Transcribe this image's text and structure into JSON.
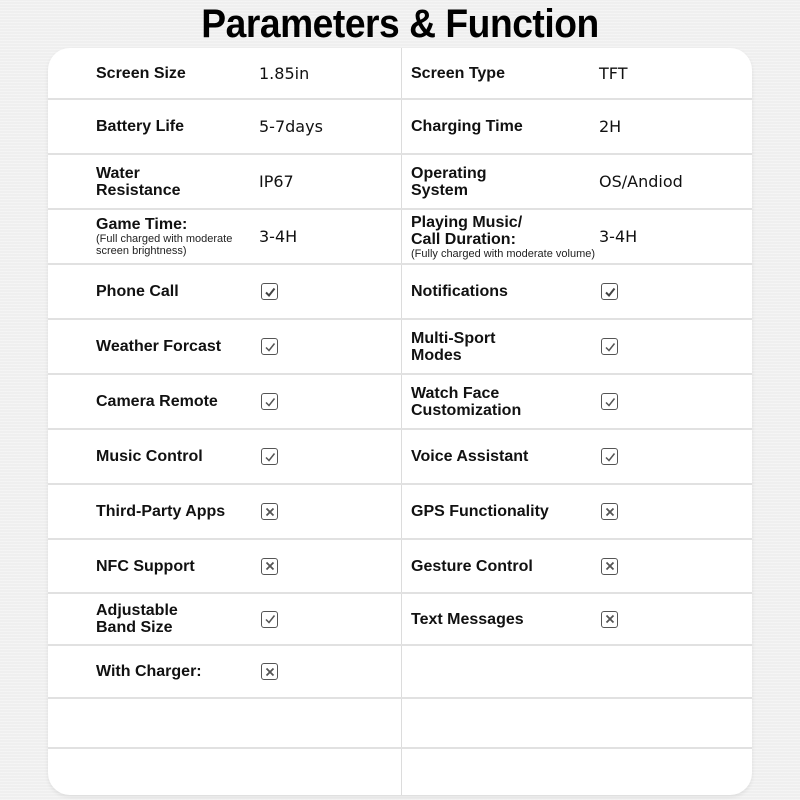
{
  "title": "Parameters & Function",
  "rows": [
    {
      "left": {
        "label": "Screen Size",
        "value": "1.85in"
      },
      "right": {
        "label": "Screen Type",
        "value": "TFT"
      }
    },
    {
      "left": {
        "label": "Battery Life",
        "value": "5-7days"
      },
      "right": {
        "label": "Charging Time",
        "value": "2H"
      }
    },
    {
      "left": {
        "label": "Water Resistance",
        "label_lines": [
          "Water",
          "Resistance"
        ],
        "value": "IP67"
      },
      "right": {
        "label": "Operating System",
        "label_lines": [
          "Operating",
          "System"
        ],
        "value": "OS/Andiod"
      }
    },
    {
      "left": {
        "label": "Game Time:",
        "note": "(Full charged with moderate screen brightness)",
        "note_lines": [
          "(Full charged with moderate",
          "screen brightness)"
        ],
        "value": "3-4H"
      },
      "right": {
        "label": "Playing Music/ Call Duration:",
        "label_lines": [
          "Playing Music/",
          "Call Duration:"
        ],
        "note": "(Fully charged with moderate volume)",
        "value": "3-4H"
      }
    },
    {
      "left": {
        "label": "Phone Call",
        "supported": true,
        "icon": "checkbox-checked-icon"
      },
      "right": {
        "label": "Notifications",
        "supported": true,
        "icon": "checkbox-checked-icon"
      }
    },
    {
      "left": {
        "label": "Weather Forcast",
        "supported": true,
        "icon": "checkbox-checked-icon"
      },
      "right": {
        "label": "Multi-Sport Modes",
        "label_lines": [
          "Multi-Sport",
          "Modes"
        ],
        "supported": true,
        "icon": "checkbox-checked-icon"
      }
    },
    {
      "left": {
        "label": "Camera Remote",
        "supported": true,
        "icon": "checkbox-checked-icon"
      },
      "right": {
        "label": "Watch Face Customization",
        "label_lines": [
          "Watch Face",
          "Customization"
        ],
        "supported": true,
        "icon": "checkbox-checked-icon"
      }
    },
    {
      "left": {
        "label": "Music Control",
        "supported": true,
        "icon": "checkbox-checked-icon"
      },
      "right": {
        "label": "Voice Assistant",
        "supported": true,
        "icon": "checkbox-checked-icon"
      }
    },
    {
      "left": {
        "label": "Third-Party Apps",
        "supported": false,
        "icon": "checkbox-crossed-icon"
      },
      "right": {
        "label": "GPS Functionality",
        "supported": false,
        "icon": "checkbox-crossed-icon"
      }
    },
    {
      "left": {
        "label": "NFC Support",
        "supported": false,
        "icon": "checkbox-crossed-icon"
      },
      "right": {
        "label": "Gesture Control",
        "supported": false,
        "icon": "checkbox-crossed-icon"
      }
    },
    {
      "left": {
        "label": "Adjustable Band Size",
        "label_lines": [
          "Adjustable",
          "Band Size"
        ],
        "supported": true,
        "icon": "checkbox-checked-icon"
      },
      "right": {
        "label": "Text Messages",
        "supported": false,
        "icon": "checkbox-crossed-icon"
      }
    },
    {
      "left": {
        "label": "With Charger:",
        "supported": false,
        "icon": "checkbox-crossed-icon"
      },
      "right": {}
    },
    {
      "left": {},
      "right": {}
    },
    {
      "left": {},
      "right": {}
    }
  ]
}
